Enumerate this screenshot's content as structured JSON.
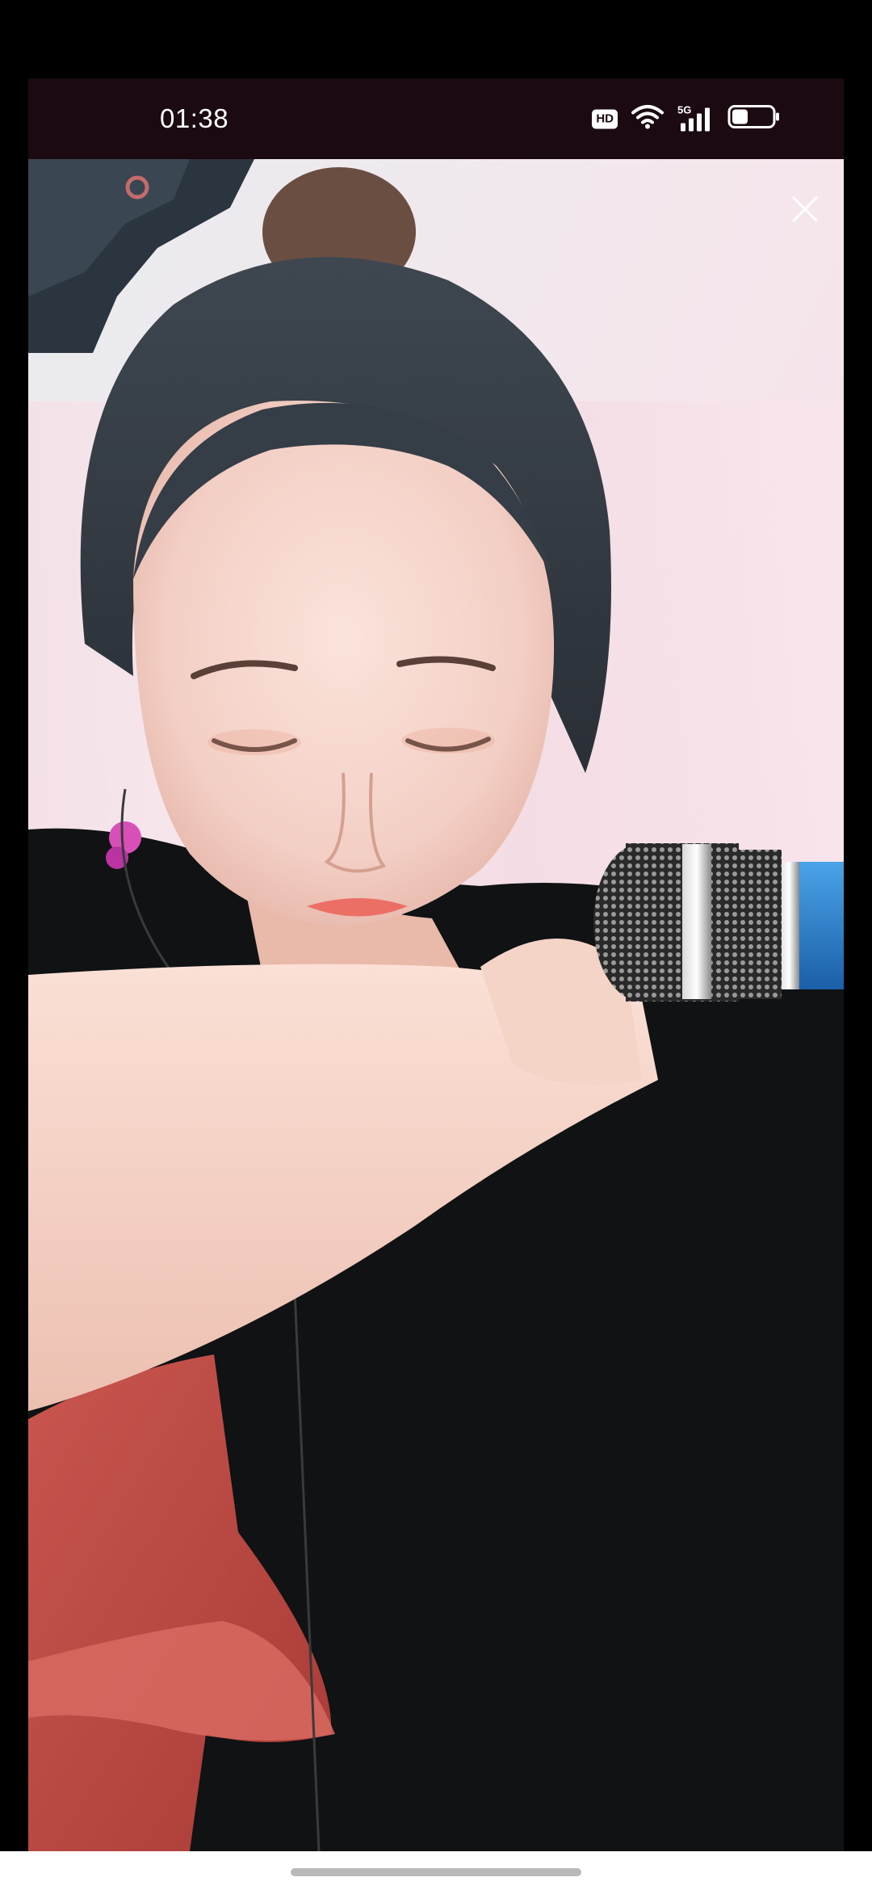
{
  "status_bar": {
    "time": "01:38",
    "hd_label": "HD",
    "network_label": "5G",
    "battery_level": 0.4
  },
  "video": {
    "close_icon": "close-icon"
  },
  "colors": {
    "status_bar_bg": "#1b0a12",
    "bottom_bar_bg": "#ffffff",
    "home_indicator": "#b9b9b9"
  }
}
